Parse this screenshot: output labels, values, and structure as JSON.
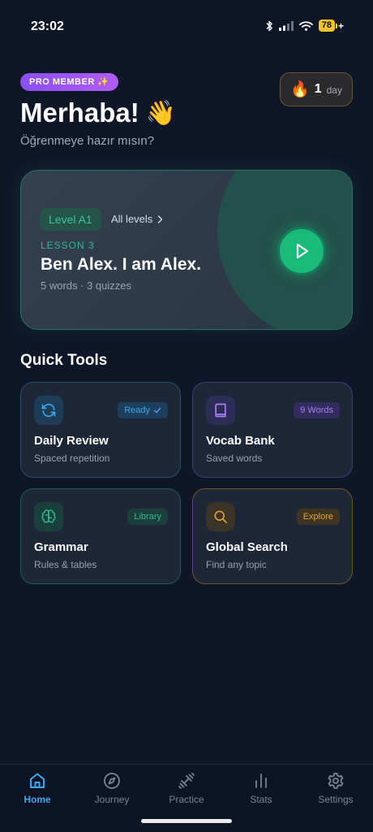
{
  "status_bar": {
    "time": "23:02",
    "battery": "78",
    "battery_charging": "+"
  },
  "header": {
    "pro_badge": "PRO MEMBER ✨",
    "streak_count": "1",
    "streak_unit": "day",
    "title": "Merhaba!",
    "title_emoji": "👋",
    "subtitle": "Öğrenmeye hazır mısın?"
  },
  "lesson": {
    "level": "Level A1",
    "all_levels": "All levels",
    "label": "LESSON 3",
    "title": "Ben Alex. I am Alex.",
    "meta": "5 words · 3 quizzes"
  },
  "quick_tools": {
    "title": "Quick Tools",
    "items": [
      {
        "title": "Daily Review",
        "subtitle": "Spaced repetition",
        "badge": "Ready",
        "icon": "refresh-icon",
        "color": "#3ea6e8"
      },
      {
        "title": "Vocab Bank",
        "subtitle": "Saved words",
        "badge": "9 Words",
        "icon": "book-icon",
        "color": "#a680f3"
      },
      {
        "title": "Grammar",
        "subtitle": "Rules & tables",
        "badge": "Library",
        "icon": "brain-icon",
        "color": "#2fb98b"
      },
      {
        "title": "Global Search",
        "subtitle": "Find any topic",
        "badge": "Explore",
        "icon": "search-icon",
        "color": "#e0a036"
      }
    ]
  },
  "nav": {
    "items": [
      {
        "label": "Home",
        "icon": "home-icon",
        "active": true
      },
      {
        "label": "Journey",
        "icon": "compass-icon"
      },
      {
        "label": "Practice",
        "icon": "dumbbell-icon"
      },
      {
        "label": "Stats",
        "icon": "bar-chart-icon"
      },
      {
        "label": "Settings",
        "icon": "gear-icon"
      }
    ]
  },
  "colors": {
    "background": "#0e1628",
    "accent": "#38a8f0",
    "lesson_accent": "#1aba7a",
    "pro": "#8a4ff0"
  }
}
